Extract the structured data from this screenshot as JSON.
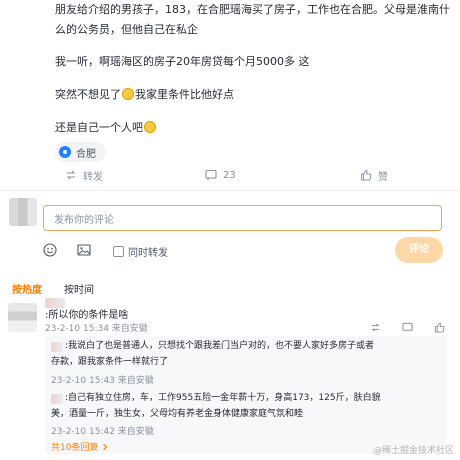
{
  "post": {
    "line1": "朋友给介绍的男孩子，183，在合肥瑶海买了房子，工作也在合肥。父母是淮南什么的公务员，但他自己在私企",
    "line2": "我一听，啊瑶海区的房子20年房贷每个月5000多 这",
    "line3_a": "突然不想见了",
    "line3_b": "我家里条件比他好点",
    "line4": "还是自己一个人吧",
    "emoji_icons": [
      "crying-face-emoji",
      "grinning-face-emoji"
    ]
  },
  "location": {
    "label": "合肥",
    "icon": "location-pin-icon"
  },
  "actions": {
    "share_label": "转发",
    "comment_count": "23",
    "like_label": "赞"
  },
  "comment_box": {
    "placeholder": "发布你的评论",
    "repost_label": "同时转发",
    "submit_label": "评论"
  },
  "sort": {
    "hot": "按热度",
    "time": "按时间"
  },
  "comment": {
    "text": ":所以你的条件是啥",
    "meta": "23-2-10 15:34 来自安徽"
  },
  "replies": [
    {
      "text1": ":我说白了也是普通人，只想找个跟我差门当户对的，也不要人家好多房子或者",
      "text2": "存款，跟我家条件一样就行了",
      "meta": "23-2-10 15:43 来自安徽"
    },
    {
      "text1": ":自己有独立住房，车，工作955五险一金年薪十万，身高173，125斤，肤白貌",
      "text2": "美，酒量一斤，独生女，父母均有养老金身体健康家庭气氛和睦",
      "meta": "23-2-10 15:42 来自安徽"
    }
  ],
  "more_replies": "共10条回复",
  "watermark": "@稀土掘金技术社区",
  "colors": {
    "accent": "#ff7d00",
    "input_border": "#f4a460",
    "button_disabled": "#ffd8a8",
    "link_blue": "#1e80ff"
  }
}
